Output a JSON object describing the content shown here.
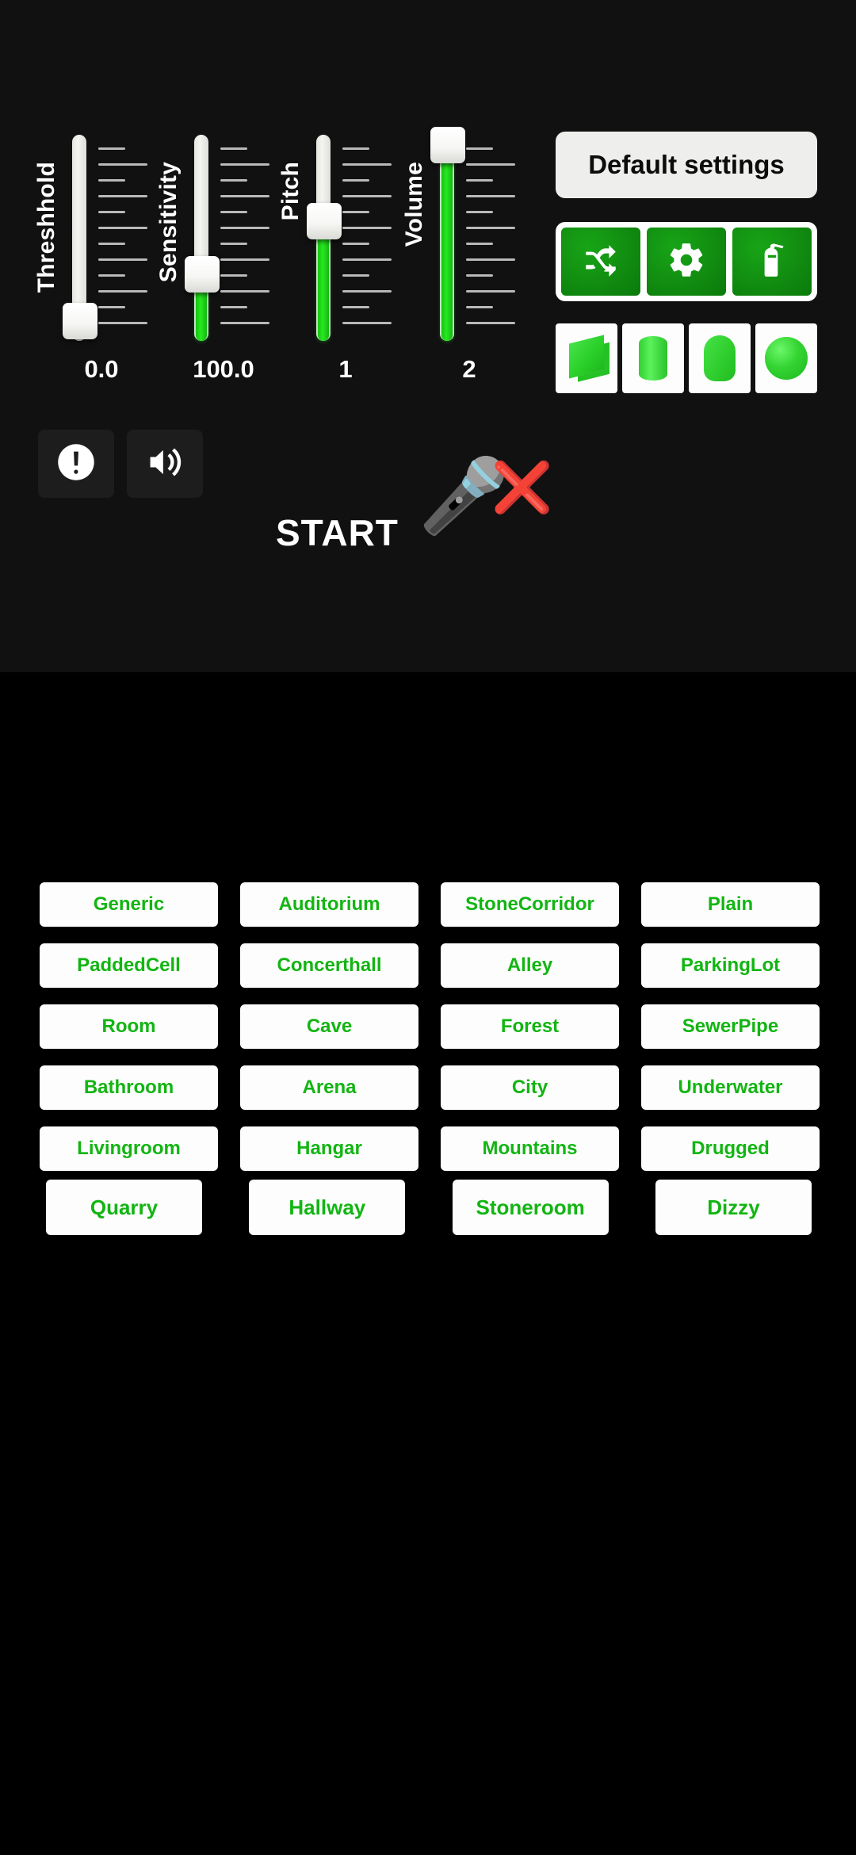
{
  "theme": {
    "panel_bg": "#111111",
    "page_bg": "#000000",
    "accent_green": "#12b512",
    "button_green": "#118a10",
    "card_white": "#fdfdfd"
  },
  "sliders": [
    {
      "label": "Threshhold",
      "value": "0.0",
      "fill_percent": 0,
      "thumb_percent": 100
    },
    {
      "label": "Sensitivity",
      "value": "100.0",
      "fill_percent": 32,
      "thumb_percent": 68
    },
    {
      "label": "Pitch",
      "value": "1",
      "fill_percent": 60,
      "thumb_percent": 40
    },
    {
      "label": "Volume",
      "value": "2",
      "fill_percent": 98,
      "thumb_percent": 2
    }
  ],
  "default_settings": {
    "label": "Default settings"
  },
  "icon_buttons": [
    {
      "name": "shuffle-icon",
      "label": "shuffle"
    },
    {
      "name": "gear-icon",
      "label": "settings"
    },
    {
      "name": "extinguisher-icon",
      "label": "fire-extinguisher"
    }
  ],
  "shape_buttons": [
    {
      "name": "box-shape-icon",
      "label": "box"
    },
    {
      "name": "cylinder-shape-icon",
      "label": "cylinder"
    },
    {
      "name": "capsule-shape-icon",
      "label": "capsule"
    },
    {
      "name": "sphere-shape-icon",
      "label": "sphere"
    }
  ],
  "left_buttons": [
    {
      "name": "alert-icon",
      "label": "alert"
    },
    {
      "name": "speaker-icon",
      "label": "sound"
    }
  ],
  "start_row": {
    "label": "START",
    "mic_icon": "🎤",
    "error_icon": "❌"
  },
  "presets": [
    "Generic",
    "Auditorium",
    "StoneCorridor",
    "Plain",
    "PaddedCell",
    "Concerthall",
    "Alley",
    "ParkingLot",
    "Room",
    "Cave",
    "Forest",
    "SewerPipe",
    "Bathroom",
    "Arena",
    "City",
    "Underwater",
    "Livingroom",
    "Hangar",
    "Mountains",
    "Drugged"
  ],
  "extra_presets": [
    "Quarry",
    "Hallway",
    "Stoneroom",
    "Dizzy"
  ]
}
